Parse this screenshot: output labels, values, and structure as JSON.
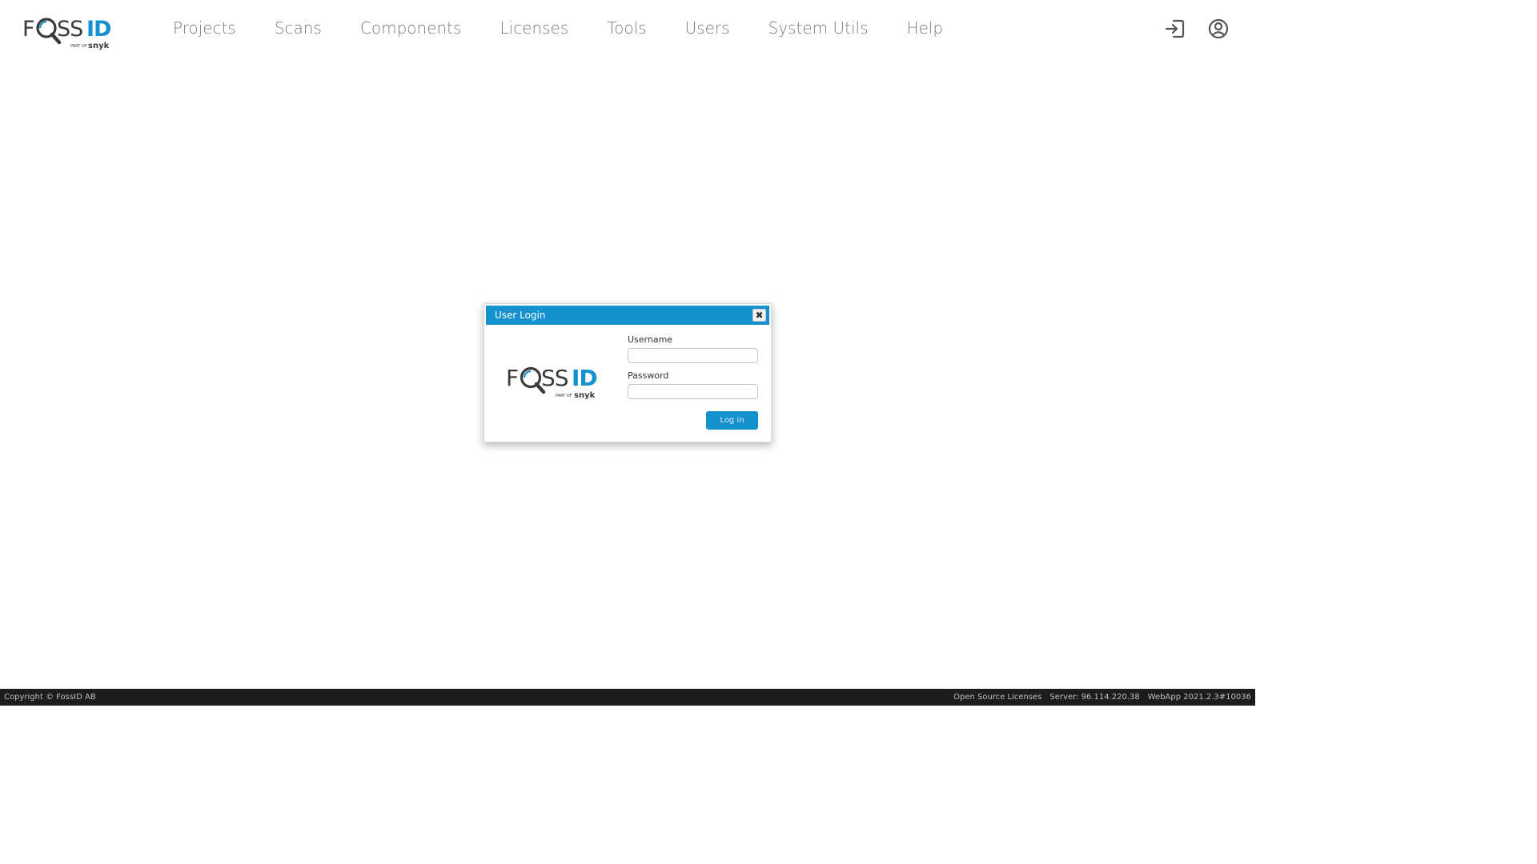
{
  "brand": {
    "logo_text_black": "FOSS",
    "logo_text_blue": "ID",
    "logo_tagline_small": "PART OF",
    "logo_tagline_brand": "snyk",
    "accent_color": "#1591cf"
  },
  "nav": {
    "items": [
      {
        "label": "Projects"
      },
      {
        "label": "Scans"
      },
      {
        "label": "Components"
      },
      {
        "label": "Licenses"
      },
      {
        "label": "Tools"
      },
      {
        "label": "Users"
      },
      {
        "label": "System Utils"
      },
      {
        "label": "Help"
      }
    ]
  },
  "header_icons": {
    "login": "login-icon",
    "account": "user-circle-icon"
  },
  "dialog": {
    "title": "User Login",
    "close_symbol": "✖",
    "username_label": "Username",
    "username_value": "",
    "password_label": "Password",
    "password_value": "",
    "login_button": "Log in"
  },
  "footer": {
    "copyright": "Copyright © FossID AB",
    "open_source_licenses": "Open Source Licenses",
    "server": "Server: 96.114.220.38",
    "webapp": "WebApp 2021.2.3#10036"
  }
}
